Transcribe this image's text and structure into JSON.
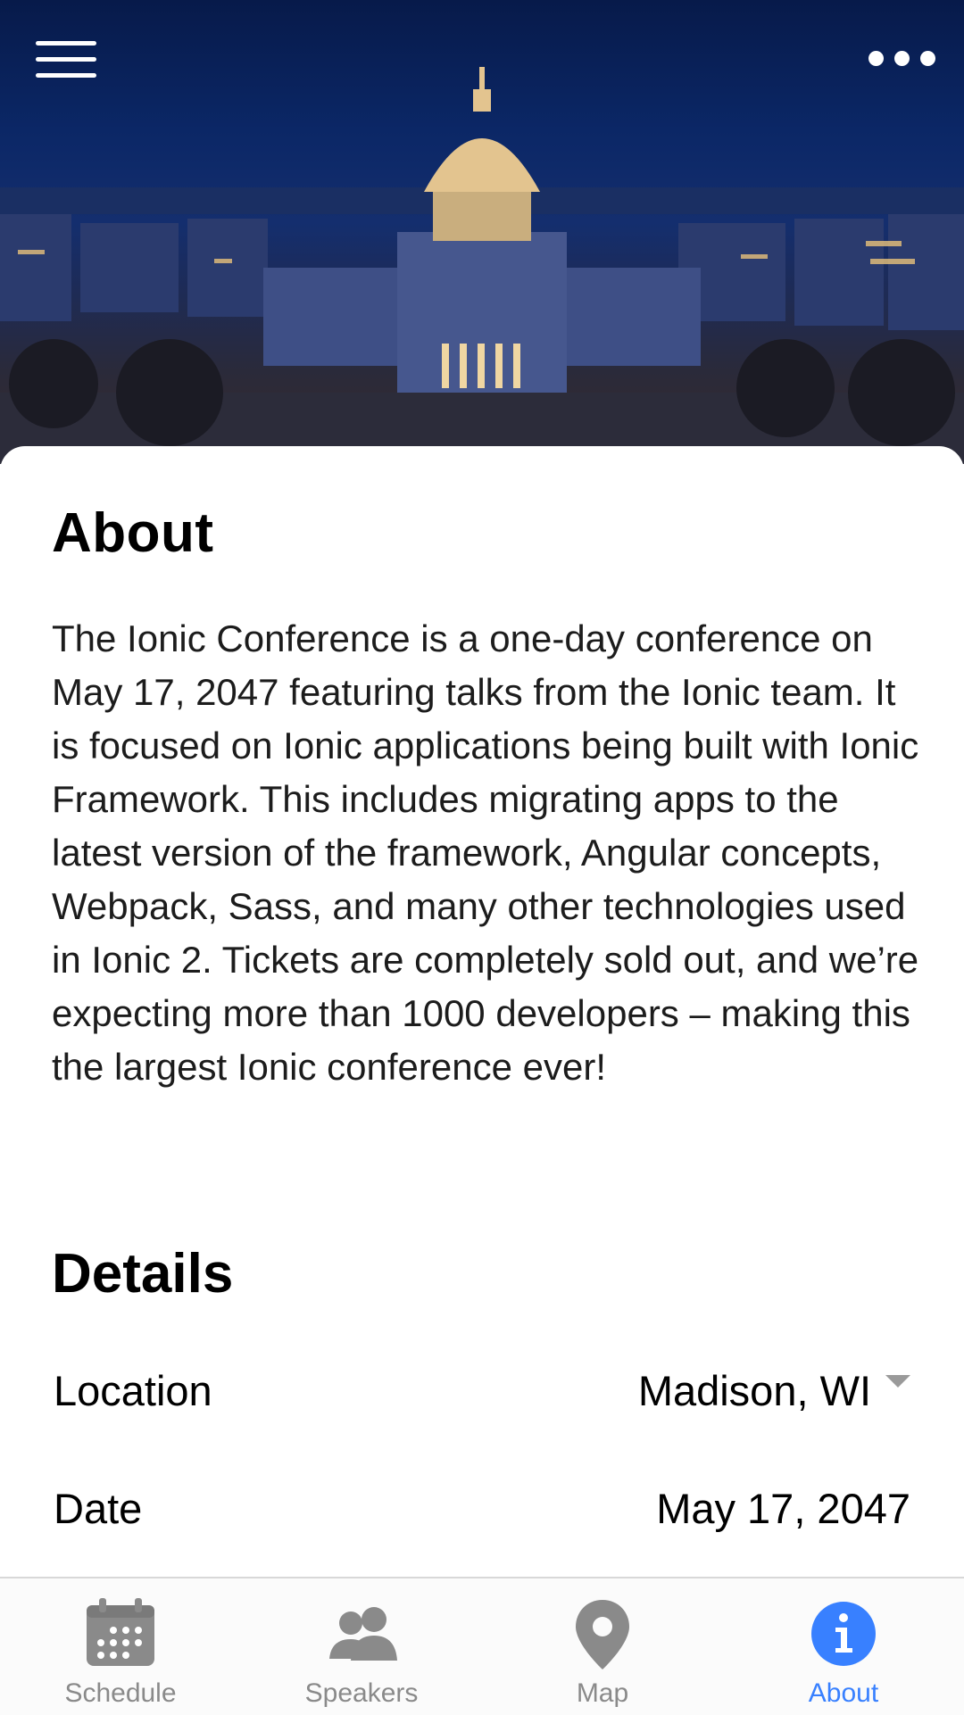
{
  "header": {
    "menu_icon": "menu-icon",
    "more_icon": "more-icon",
    "hero_image": "capitol-building-night-photo"
  },
  "about": {
    "title": "About",
    "paragraph": "The Ionic Conference is a one-day conference on May 17, 2047 featuring talks from the Ionic team. It is focused on Ionic applications being built with Ionic Framework. This includes migrating apps to the latest version of the framework, Angular concepts, Webpack, Sass, and many other technologies used in Ionic 2. Tickets are completely sold out, and we’re expecting more than 1000 developers – making this the largest Ionic conference ever!"
  },
  "details": {
    "title": "Details",
    "location_label": "Location",
    "location_value": "Madison, WI",
    "date_label": "Date",
    "date_value": "May 17, 2047"
  },
  "tabs": [
    {
      "label": "Schedule",
      "icon": "calendar-icon"
    },
    {
      "label": "Speakers",
      "icon": "people-icon"
    },
    {
      "label": "Map",
      "icon": "location-pin-icon"
    },
    {
      "label": "About",
      "icon": "info-icon",
      "active": true
    }
  ],
  "colors": {
    "accent": "#3880ff",
    "tab_inactive": "#8a8a8a"
  }
}
